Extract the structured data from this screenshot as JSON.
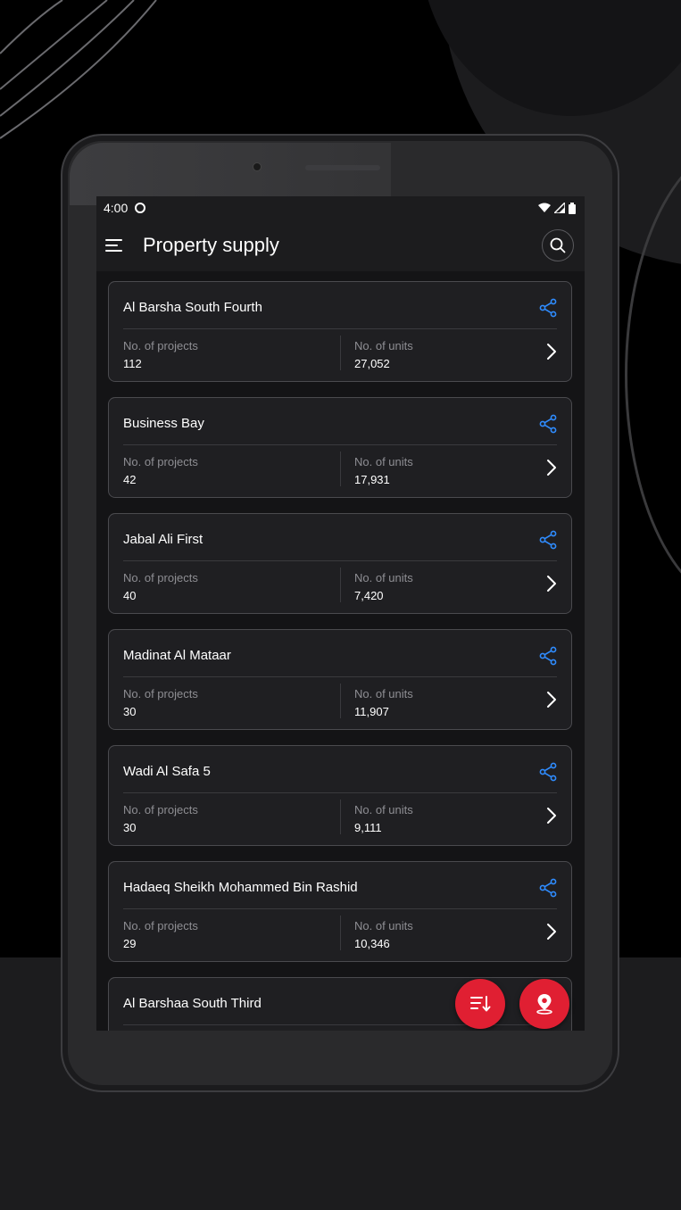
{
  "status_bar": {
    "time": "4:00"
  },
  "app_bar": {
    "title": "Property supply"
  },
  "labels": {
    "projects": "No. of projects",
    "units": "No. of units"
  },
  "areas": [
    {
      "name": "Al Barsha South Fourth",
      "projects": "112",
      "units": "27,052"
    },
    {
      "name": "Business Bay",
      "projects": "42",
      "units": "17,931"
    },
    {
      "name": "Jabal Ali First",
      "projects": "40",
      "units": "7,420"
    },
    {
      "name": "Madinat Al Mataar",
      "projects": "30",
      "units": "11,907"
    },
    {
      "name": "Wadi Al Safa 5",
      "projects": "30",
      "units": "9,111"
    },
    {
      "name": "Hadaeq Sheikh Mohammed Bin Rashid",
      "projects": "29",
      "units": "10,346"
    },
    {
      "name": "Al Barshaa South Third"
    }
  ],
  "colors": {
    "accent": "#e01f32",
    "share": "#2f8cff",
    "background": "#1c1c1e"
  },
  "icons": {
    "menu": "menu-icon",
    "search": "search-icon",
    "share": "share-icon",
    "chevron": "chevron-right-icon",
    "sort": "sort-icon",
    "map": "map-pin-icon"
  }
}
